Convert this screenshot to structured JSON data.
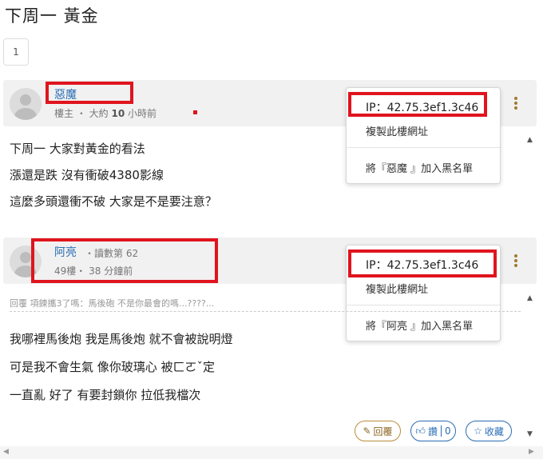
{
  "page": {
    "title": "下周一 黃金"
  },
  "pagination": {
    "current": "1"
  },
  "posts": [
    {
      "author": "惡魔",
      "floor": "樓主",
      "time_prefix": "大約",
      "time_num": "10",
      "time_unit": "小時前",
      "lines": [
        "下周一 大家對黃金的看法",
        "漲還是跌 沒有衝破4380影線",
        "這麼多頭還衝不破 大家是不是要注意？"
      ],
      "popup": {
        "ip": "IP：42.75.3ef1.3c46",
        "copy": "複製此樓網址",
        "block": "將『惡魔 』加入黑名單"
      }
    },
    {
      "author": "阿亮",
      "badge": "・讀數第 62",
      "floor": "49樓・",
      "time": "38 分鐘前",
      "reply_ref": "回覆 項鍊攜3了嗎：馬後砲 不是你最會的嗎...????...",
      "lines": [
        "我哪裡馬後炮 我是馬後炮 就不會被說明燈",
        "可是我不會生氣 像你玻璃心 被ㄈㄛˇ定",
        "一直亂 好了 有要封鎖你 拉低我檔次"
      ],
      "popup": {
        "ip": "IP：42.75.3ef1.3c46",
        "copy": "複製此樓網址",
        "block": "將『阿亮 』加入黑名單"
      },
      "actions": {
        "reply": "回覆",
        "like": "讚",
        "like_count": "0",
        "save": "收藏"
      }
    }
  ],
  "colors": {
    "highlight": "#e0141e",
    "author": "#2a6db4",
    "kebab": "#a07a2c"
  }
}
